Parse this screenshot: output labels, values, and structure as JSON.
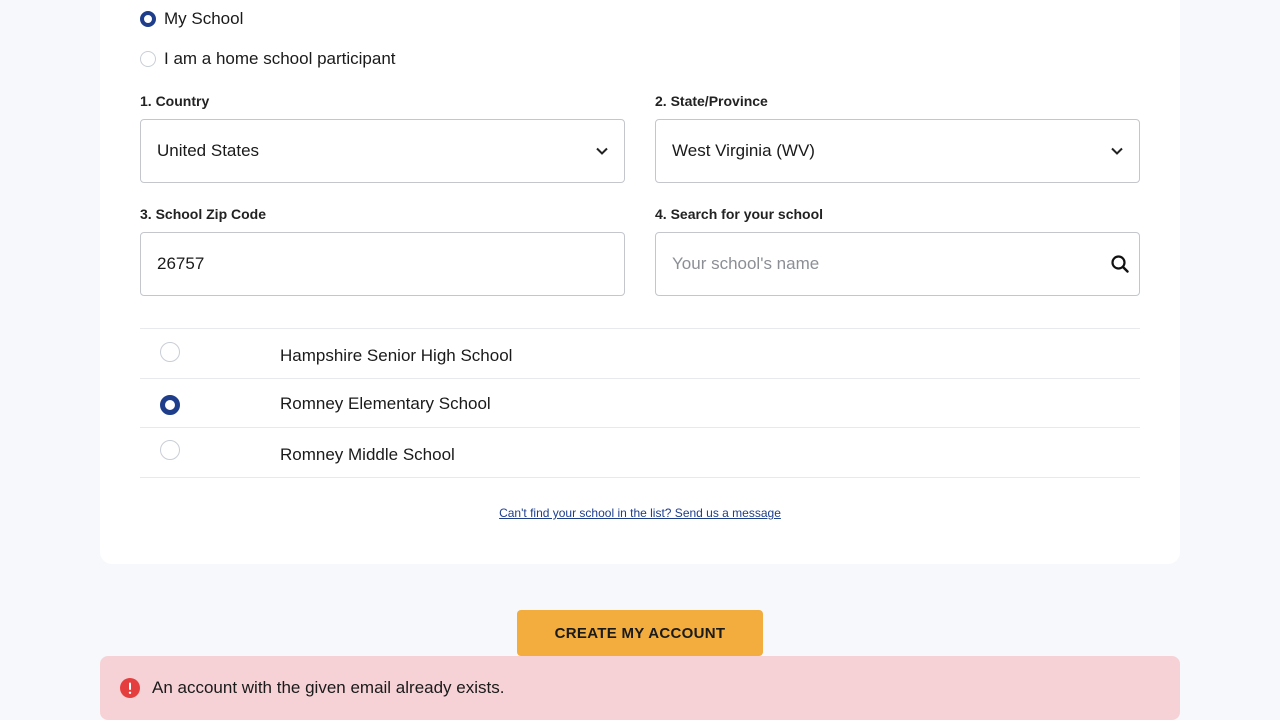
{
  "school_type": {
    "options": [
      {
        "label": "My School",
        "selected": true
      },
      {
        "label": "I am a home school participant",
        "selected": false
      }
    ]
  },
  "form": {
    "country": {
      "label": "1. Country",
      "value": "United States"
    },
    "state": {
      "label": "2. State/Province",
      "value": "West Virginia (WV)"
    },
    "zip": {
      "label": "3. School Zip Code",
      "value": "26757"
    },
    "search": {
      "label": "4. Search for your school",
      "placeholder": "Your school's name",
      "value": ""
    }
  },
  "schools": [
    {
      "name": "Hampshire Senior High School",
      "selected": false
    },
    {
      "name": "Romney Elementary School",
      "selected": true
    },
    {
      "name": "Romney Middle School",
      "selected": false
    }
  ],
  "help_link": "Can't find your school in the list? Send us a message",
  "create_button": "CREATE MY ACCOUNT",
  "alert": {
    "message": "An account with the given email already exists.",
    "color": "#e53e3e"
  },
  "colors": {
    "accent": "#1e3e8c",
    "button": "#f2ad3e",
    "alert_bg": "#f6d2d6"
  },
  "icons": {
    "select": "chevron-down-icon",
    "search": "search-icon",
    "alert": "error-icon"
  }
}
